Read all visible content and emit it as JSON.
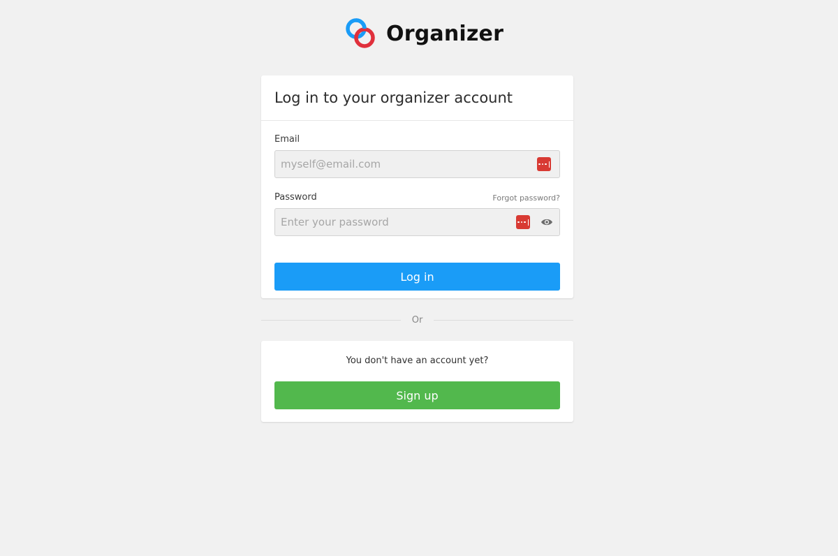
{
  "brand": {
    "name": "Organizer",
    "logo_icon": "interlocking-rings-logo",
    "colors": {
      "ring_blue": "#1a9cf7",
      "ring_red": "#e0303c"
    }
  },
  "login": {
    "title": "Log in to your organizer account",
    "email": {
      "label": "Email",
      "placeholder": "myself@email.com",
      "value": ""
    },
    "password": {
      "label": "Password",
      "placeholder": "Enter your password",
      "value": "",
      "forgot_label": "Forgot password?"
    },
    "submit_label": "Log in",
    "submit_color": "#1a9cf7"
  },
  "divider": {
    "label": "Or"
  },
  "signup": {
    "prompt": "You don't have an account yet?",
    "button_label": "Sign up",
    "button_color": "#52b84d"
  },
  "icons": {
    "password_manager": "password-manager-icon",
    "reveal_password": "eye-icon"
  }
}
